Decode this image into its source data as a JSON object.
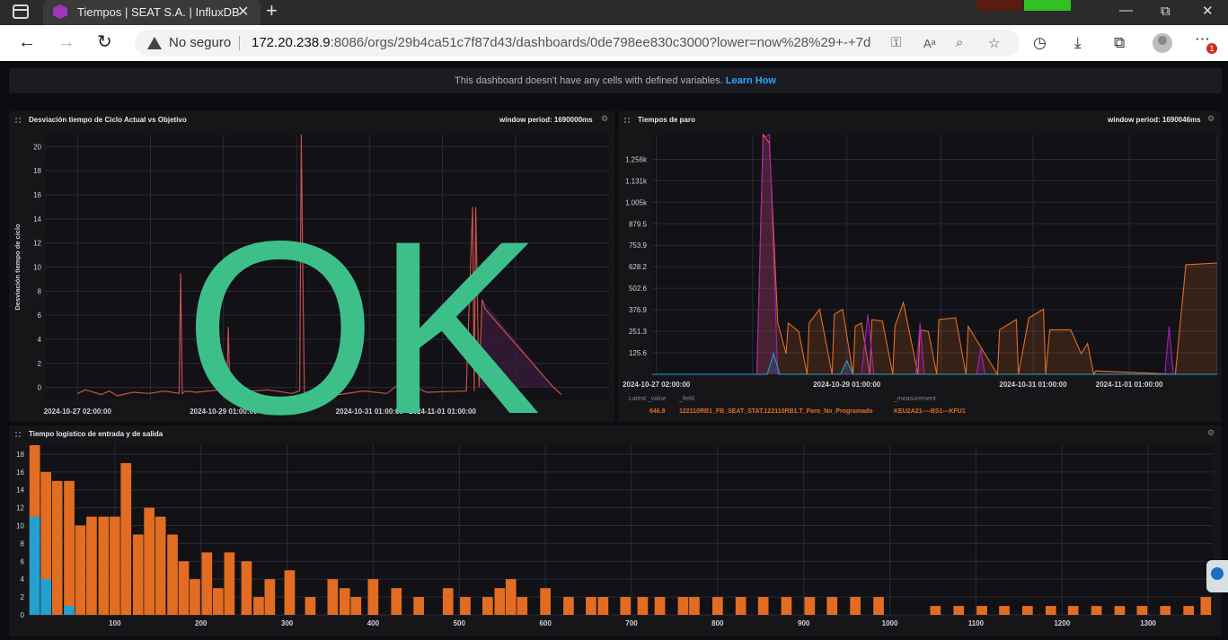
{
  "browser": {
    "tab_title": "Tiempos | SEAT S.A. | InfluxDB",
    "tab_close": "✕",
    "new_tab": "+",
    "security_label": "No seguro",
    "url_host": "172.20.238.9",
    "url_rest": ":8086/orgs/29b4ca51c7f87d43/dashboards/0de798ee830c3000?lower=now%28%29+-+7d",
    "badge": "1",
    "icons": [
      "tab-actions-icon",
      "back-icon",
      "forward-icon",
      "refresh-icon",
      "warning-icon",
      "key-icon",
      "read-aloud-icon",
      "zoom-icon",
      "add-favorite-icon",
      "history-icon",
      "download-icon",
      "collections-icon",
      "profile-icon",
      "more-icon",
      "minimize-icon",
      "maximize-icon",
      "close-icon"
    ]
  },
  "dashboard": {
    "notice_text": "This dashboard doesn't have any cells with defined variables.",
    "notice_link": "Learn How"
  },
  "cells": {
    "cycle": {
      "title": "Desviación tiempo de Ciclo Actual vs Objetivo",
      "window": "window period: 1690000ms",
      "overlay_text": "OK"
    },
    "stops": {
      "title": "Tiempos de paro",
      "window": "window period: 1690046ms",
      "legend_headers": [
        "Latest _value",
        "_field",
        "_measurement"
      ],
      "legend_values": [
        "646.8",
        "122110RB1_FB_SEAT_STAT.122110RB1.T_Paro_No_Programado",
        "KEU2A21----BS1---KFU1"
      ]
    },
    "logistic": {
      "title": "Tiempo logístico de entrada y de salida"
    }
  },
  "colors": {
    "orange": "#e26d22",
    "blue": "#22a0d0",
    "purple": "#a321b8",
    "ok_green": "#3dbf8a",
    "red_line": "#c8504a"
  },
  "chart_data": [
    {
      "type": "line",
      "title": "Desviación tiempo de Ciclo Actual vs Objetivo",
      "ylabel": "Desviación tiempo de ciclo",
      "xlabel": "",
      "ylim": [
        -1,
        21
      ],
      "yticks": [
        0,
        2,
        4,
        6,
        8,
        10,
        12,
        14,
        16,
        18,
        20
      ],
      "xticks": [
        "2024-10-27 02:00:00",
        "2024-10-29 01:00:00",
        "2024-10-31 01:00:00",
        "2024-11-01 01:00:00"
      ],
      "series": [
        {
          "x": [
            0,
            0.5,
            1.5,
            2.0,
            2.5,
            3.5,
            4.5,
            5.5,
            6.4,
            6.5,
            6.6,
            6.8,
            7.5,
            9.0,
            9.4,
            9.5,
            9.6,
            10.0,
            12.0,
            13.5,
            14.0,
            14.1,
            14.2,
            14.3,
            14.4,
            15.5,
            16.5,
            18.0,
            19.5,
            20.5,
            22.0,
            24.5,
            24.9,
            25.0,
            25.1,
            25.3,
            25.5,
            25.7,
            30.0,
            30.5
          ],
          "y": [
            -0.5,
            -0.2,
            -0.6,
            -0.3,
            -0.7,
            -0.4,
            -0.5,
            -0.3,
            -0.5,
            9.5,
            -0.5,
            -0.3,
            -0.4,
            -0.2,
            -0.3,
            5,
            -0.3,
            -0.4,
            -0.2,
            -0.5,
            -0.3,
            21,
            9.5,
            -0.8,
            -0.4,
            -0.2,
            -0.6,
            -0.3,
            -0.5,
            0.5,
            -0.4,
            -0.3,
            15,
            -0.3,
            15,
            0,
            7.3,
            6.5,
            0,
            -0.6
          ]
        }
      ]
    },
    {
      "type": "area",
      "title": "Tiempos de paro",
      "ylim": [
        0,
        1400
      ],
      "yticks": [
        125.6,
        251.3,
        376.9,
        502.6,
        628.2,
        753.9,
        879.5,
        "1.005k",
        "1.131k",
        "1.256k"
      ],
      "xticks": [
        "2024-10-27 02:00:00",
        "2024-10-29 01:00:00",
        "2024-10-31 01:00:00",
        "2024-11-01 01:00:00"
      ],
      "series": [
        {
          "name": "122110RB1_FB_SEAT_STAT.122110RB1.T_Paro_No_Programado",
          "color": "#e26d22",
          "x": [
            0,
            5.0,
            5.3,
            5.6,
            6.0,
            6.4,
            6.5,
            7.0,
            7.4,
            7.5,
            8.0,
            8.6,
            8.7,
            9.1,
            9.6,
            9.7,
            10.0,
            10.4,
            10.5,
            11.0,
            11.5,
            11.6,
            12.0,
            12.7,
            12.8,
            13.2,
            13.6,
            13.7,
            14.5,
            15.0,
            15.1,
            15.5,
            16.5,
            16.6,
            17.4,
            17.5,
            18.0,
            18.7,
            18.8,
            19.0,
            20.0,
            20.5,
            20.8,
            21.1,
            21.2,
            25.0,
            25.5,
            27.0
          ],
          "y": [
            0,
            0,
            1400,
            1350,
            300,
            120,
            300,
            250,
            0,
            300,
            380,
            0,
            350,
            380,
            0,
            280,
            300,
            0,
            320,
            310,
            0,
            280,
            420,
            0,
            260,
            250,
            0,
            320,
            330,
            0,
            280,
            200,
            0,
            260,
            320,
            0,
            330,
            380,
            0,
            260,
            260,
            120,
            180,
            0,
            20,
            0,
            640,
            650
          ]
        },
        {
          "name": "purple",
          "color": "#a321b8",
          "x": [
            0,
            5.0,
            5.3,
            5.6,
            6.0,
            10.0,
            10.3,
            10.6,
            11.0,
            12.6,
            12.8,
            13.0,
            15.5,
            15.7,
            15.9,
            16.5,
            22.0,
            24.5,
            24.7,
            24.9,
            27.0
          ],
          "y": [
            0,
            0,
            1380,
            1400,
            0,
            0,
            350,
            0,
            0,
            0,
            300,
            0,
            0,
            150,
            0,
            0,
            0,
            0,
            280,
            0,
            0
          ]
        },
        {
          "name": "blue",
          "color": "#22a0d0",
          "x": [
            0,
            5.5,
            5.8,
            6.1,
            9.0,
            9.3,
            9.6,
            27.0
          ],
          "y": [
            0,
            0,
            120,
            0,
            0,
            80,
            0,
            0
          ]
        }
      ]
    },
    {
      "type": "bar",
      "title": "Tiempo logístico de entrada y de salida",
      "ylim": [
        0,
        19
      ],
      "yticks": [
        0,
        2,
        4,
        6,
        8,
        10,
        12,
        14,
        16,
        18
      ],
      "xlim": [
        0,
        1375
      ],
      "xticks": [
        100,
        200,
        300,
        400,
        500,
        600,
        700,
        800,
        900,
        1000,
        1100,
        1200,
        1300
      ],
      "bin_width": 13.3,
      "series": [
        {
          "name": "orange",
          "color": "#e26d22",
          "x": [
            7,
            20,
            33,
            47,
            60,
            73,
            87,
            100,
            113,
            127,
            140,
            153,
            167,
            180,
            193,
            207,
            220,
            233,
            253,
            267,
            280,
            303,
            327,
            353,
            367,
            380,
            400,
            427,
            453,
            487,
            507,
            533,
            547,
            560,
            573,
            600,
            627,
            653,
            667,
            693,
            713,
            733,
            760,
            773,
            800,
            827,
            853,
            880,
            907,
            933,
            960,
            987,
            1053,
            1080,
            1107,
            1133,
            1160,
            1187,
            1213,
            1240,
            1267,
            1293,
            1320,
            1347,
            1367
          ],
          "y": [
            19,
            16,
            15,
            15,
            10,
            11,
            11,
            11,
            17,
            9,
            12,
            11,
            9,
            6,
            4,
            7,
            3,
            7,
            6,
            2,
            4,
            5,
            2,
            4,
            3,
            2,
            4,
            3,
            2,
            3,
            2,
            2,
            3,
            4,
            2,
            3,
            2,
            2,
            2,
            2,
            2,
            2,
            2,
            2,
            2,
            2,
            2,
            2,
            2,
            2,
            2,
            2,
            1,
            1,
            1,
            1,
            1,
            1,
            1,
            1,
            1,
            1,
            1,
            1,
            2
          ]
        },
        {
          "name": "blue",
          "color": "#22a0d0",
          "x": [
            7,
            20,
            47
          ],
          "y": [
            11,
            4,
            1
          ]
        }
      ]
    }
  ]
}
